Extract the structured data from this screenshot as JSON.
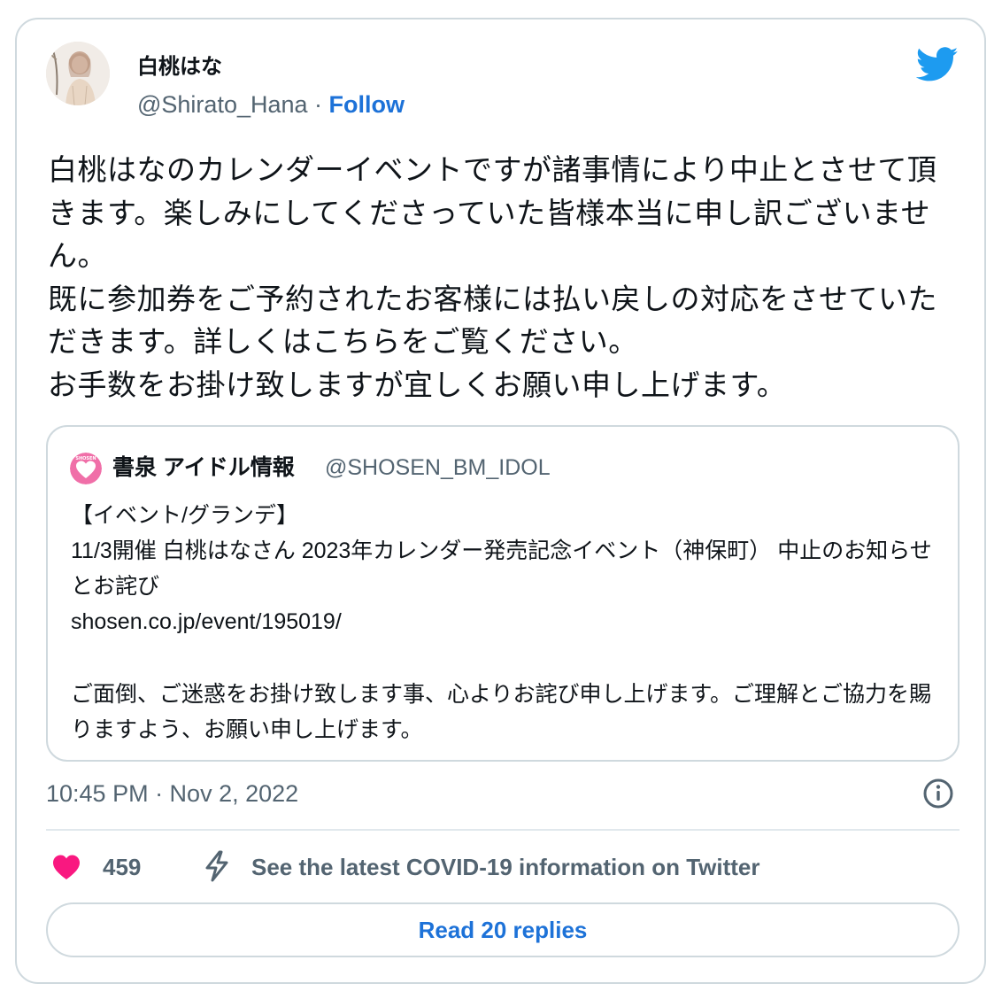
{
  "colors": {
    "accent": "#1d72d8",
    "muted": "#536471",
    "border": "#cfd9de",
    "like": "#f91880",
    "twitter": "#1d9bf0"
  },
  "author": {
    "display_name": "白桃はな",
    "handle": "@Shirato_Hana",
    "separator": " · ",
    "follow_label": "Follow",
    "avatar_icon": "profile-photo",
    "logo_icon": "twitter-bird-icon"
  },
  "tweet": {
    "lines": [
      "白桃はなのカレンダーイベントですが諸事情により中止とさせて頂きます。楽しみにしてくださっていた皆様本当に申し訳ございません。",
      "既に参加券をご予約されたお客様には払い戻しの対応をさせていただきます。詳しくはこちらをご覧ください。",
      "お手数をお掛け致しますが宜しくお願い申し上げます。"
    ]
  },
  "quote": {
    "name": "書泉 アイドル情報",
    "handle": "@SHOSEN_BM_IDOL",
    "avatar_text": "SHOSEN",
    "avatar_icon": "heart-logo",
    "lines": [
      "【イベント/グランデ】",
      "11/3開催 白桃はなさん 2023年カレンダー発売記念イベント（神保町） 中止のお知らせとお詫び",
      "shosen.co.jp/event/195019/",
      "",
      "ご面倒、ご迷惑をお掛け致します事、心よりお詫び申し上げます。ご理解とご協力を賜りますよう、お願い申し上げます。"
    ]
  },
  "meta": {
    "timestamp": "10:45 PM · Nov 2, 2022",
    "info_icon": "info-icon"
  },
  "actions": {
    "like_count": "459",
    "covid_link": "See the latest COVID-19 information on Twitter",
    "read_replies": "Read 20 replies"
  }
}
